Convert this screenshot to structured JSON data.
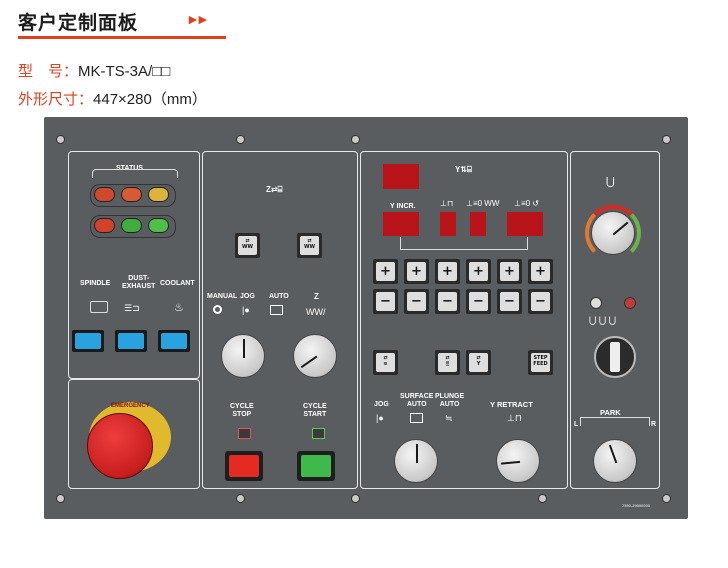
{
  "header": {
    "title": "客户定制面板",
    "arrow": "►►",
    "model_label": "型　号：",
    "model_value": "MK-TS-3A/□□",
    "size_label": "外形尺寸：",
    "size_value": "447×280（mm）"
  },
  "colors": {
    "accent": "#e0411b",
    "panel": "#5a5d60",
    "led_red": "#b8141a"
  },
  "status_section": {
    "title": "STATUS",
    "lamps_top": [
      "#cf4a2d",
      "#d65a32",
      "#dcb43a"
    ],
    "lamps_bottom": [
      "#d2422a",
      "#3fae3f",
      "#4fbf48"
    ],
    "labels": [
      "SPINDLE",
      "DUST-\nEXHAUST",
      "COOLANT"
    ],
    "buttons_color": "#29a3df"
  },
  "estop": {
    "label": "EMERGENCY"
  },
  "mode_section": {
    "mode_labels": [
      "MANUAL",
      "JOG",
      "AUTO"
    ],
    "z_label": "Z",
    "cycle_stop": "CYCLE\nSTOP",
    "cycle_start": "CYCLE\nSTART"
  },
  "axis_section": {
    "y_incr": "Y INCR.",
    "mode_labels": [
      "JOG",
      "SURFACE\nAUTO",
      "PLUNGE\nAUTO"
    ],
    "y_retract": "Y  RETRACT",
    "plus": "+",
    "minus": "−",
    "step_feed": "STEP\nFEED",
    "serial": "7550-29800000"
  },
  "right_section": {
    "park": "PARK",
    "left": "L",
    "right": "R"
  }
}
